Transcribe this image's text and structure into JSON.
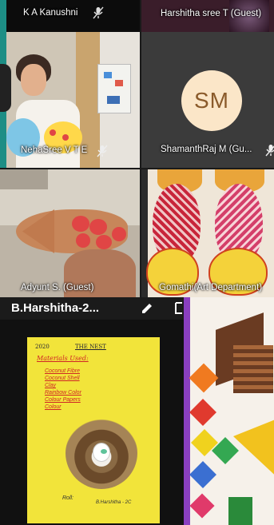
{
  "tiles": {
    "top_left": {
      "name": "K A Kanushni",
      "muted": true
    },
    "top_right": {
      "name": "Harshitha sree T (Guest)"
    },
    "mid_left": {
      "name": "NehaSree V T E",
      "muted": true
    },
    "mid_right": {
      "name": "ShamanthRaj M (Gu...",
      "initials": "SM",
      "muted": true
    },
    "row3_left": {
      "name": "Adyunt S. (Guest)"
    },
    "row3_right": {
      "name": "Gomathi(Art Department)"
    }
  },
  "presentation": {
    "title": "B.Harshitha-2...",
    "icons": [
      "pencil-icon",
      "expand-icon"
    ],
    "paper": {
      "date": "2020",
      "heading": "THE NEST",
      "subtitle": "Materials Used:",
      "items": [
        "Coconut Fibre",
        "Coconut Shell",
        "Clay",
        "Rainbow Color",
        "Colour Papers",
        "Colour"
      ],
      "signature_label": "Roll:",
      "signature": "B.Harshitha - 2C"
    }
  },
  "colors": {
    "avatar_bg": "#fbe6c8",
    "avatar_text": "#8a5a2a",
    "paper_yellow": "#f2e43a"
  }
}
